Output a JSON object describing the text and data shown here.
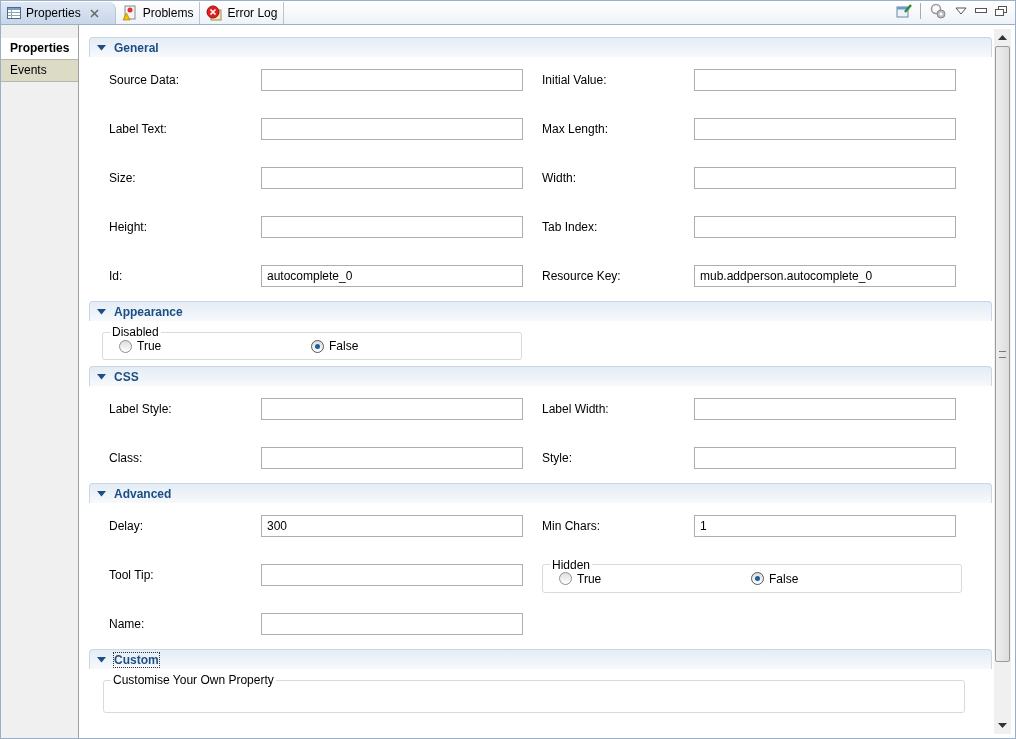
{
  "tabs": [
    {
      "label": "Properties",
      "selected": true,
      "closable": true
    },
    {
      "label": "Problems",
      "selected": false,
      "closable": false
    },
    {
      "label": "Error Log",
      "selected": false,
      "closable": false
    }
  ],
  "side_tabs": [
    {
      "label": "Properties",
      "selected": true
    },
    {
      "label": "Events",
      "selected": false
    }
  ],
  "sections": [
    {
      "title": "General",
      "expanded": true,
      "focused": false,
      "rows": [
        [
          {
            "kind": "field",
            "label": "Source Data:"
          },
          {
            "kind": "field",
            "label": "Initial Value:"
          }
        ],
        [
          {
            "kind": "field",
            "label": "Label Text:"
          },
          {
            "kind": "field",
            "label": "Max Length:"
          }
        ],
        [
          {
            "kind": "field",
            "label": "Size:"
          },
          {
            "kind": "field",
            "label": "Width:"
          }
        ],
        [
          {
            "kind": "field",
            "label": "Height:"
          },
          {
            "kind": "field",
            "label": "Tab Index:"
          }
        ],
        [
          {
            "kind": "field",
            "label": "Id:",
            "value": "autocomplete_0"
          },
          {
            "kind": "field",
            "label": "Resource Key:",
            "value": "mub.addperson.autocomplete_0"
          }
        ]
      ]
    },
    {
      "title": "Appearance",
      "expanded": true,
      "focused": false,
      "rows": [
        [
          {
            "kind": "radio-group",
            "legend": "Disabled",
            "options": [
              {
                "label": "True",
                "selected": false
              },
              {
                "label": "False",
                "selected": true
              }
            ]
          }
        ]
      ]
    },
    {
      "title": "CSS",
      "expanded": true,
      "focused": false,
      "rows": [
        [
          {
            "kind": "field",
            "label": "Label Style:"
          },
          {
            "kind": "field",
            "label": "Label Width:"
          }
        ],
        [
          {
            "kind": "field",
            "label": "Class:"
          },
          {
            "kind": "field",
            "label": "Style:"
          }
        ]
      ]
    },
    {
      "title": "Advanced",
      "expanded": true,
      "focused": false,
      "rows": [
        [
          {
            "kind": "field",
            "label": "Delay:",
            "value": "300"
          },
          {
            "kind": "field",
            "label": "Min Chars:",
            "value": "1"
          }
        ],
        [
          {
            "kind": "field",
            "label": "Tool Tip:"
          },
          {
            "kind": "radio-group",
            "legend": "Hidden",
            "options": [
              {
                "label": "True",
                "selected": false
              },
              {
                "label": "False",
                "selected": true
              }
            ]
          }
        ],
        [
          {
            "kind": "field",
            "label": "Name:"
          }
        ]
      ]
    },
    {
      "title": "Custom",
      "expanded": true,
      "focused": true,
      "rows": [
        [
          {
            "kind": "group",
            "legend": "Customise Your Own Property"
          }
        ]
      ]
    }
  ]
}
